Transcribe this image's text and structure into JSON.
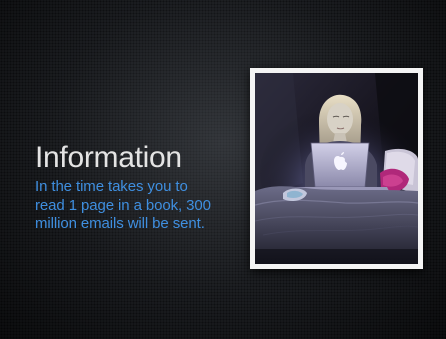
{
  "slide": {
    "title": "Information",
    "body": "In the time takes you to read 1 page in a book, 300 million emails will be sent."
  },
  "photo": {
    "laptop_logo_icon": "apple-logo-icon"
  },
  "colors": {
    "background": "#1d1f22",
    "title": "#e4e4e4",
    "body": "#3f8fe0",
    "frame": "#f4f4f4"
  }
}
